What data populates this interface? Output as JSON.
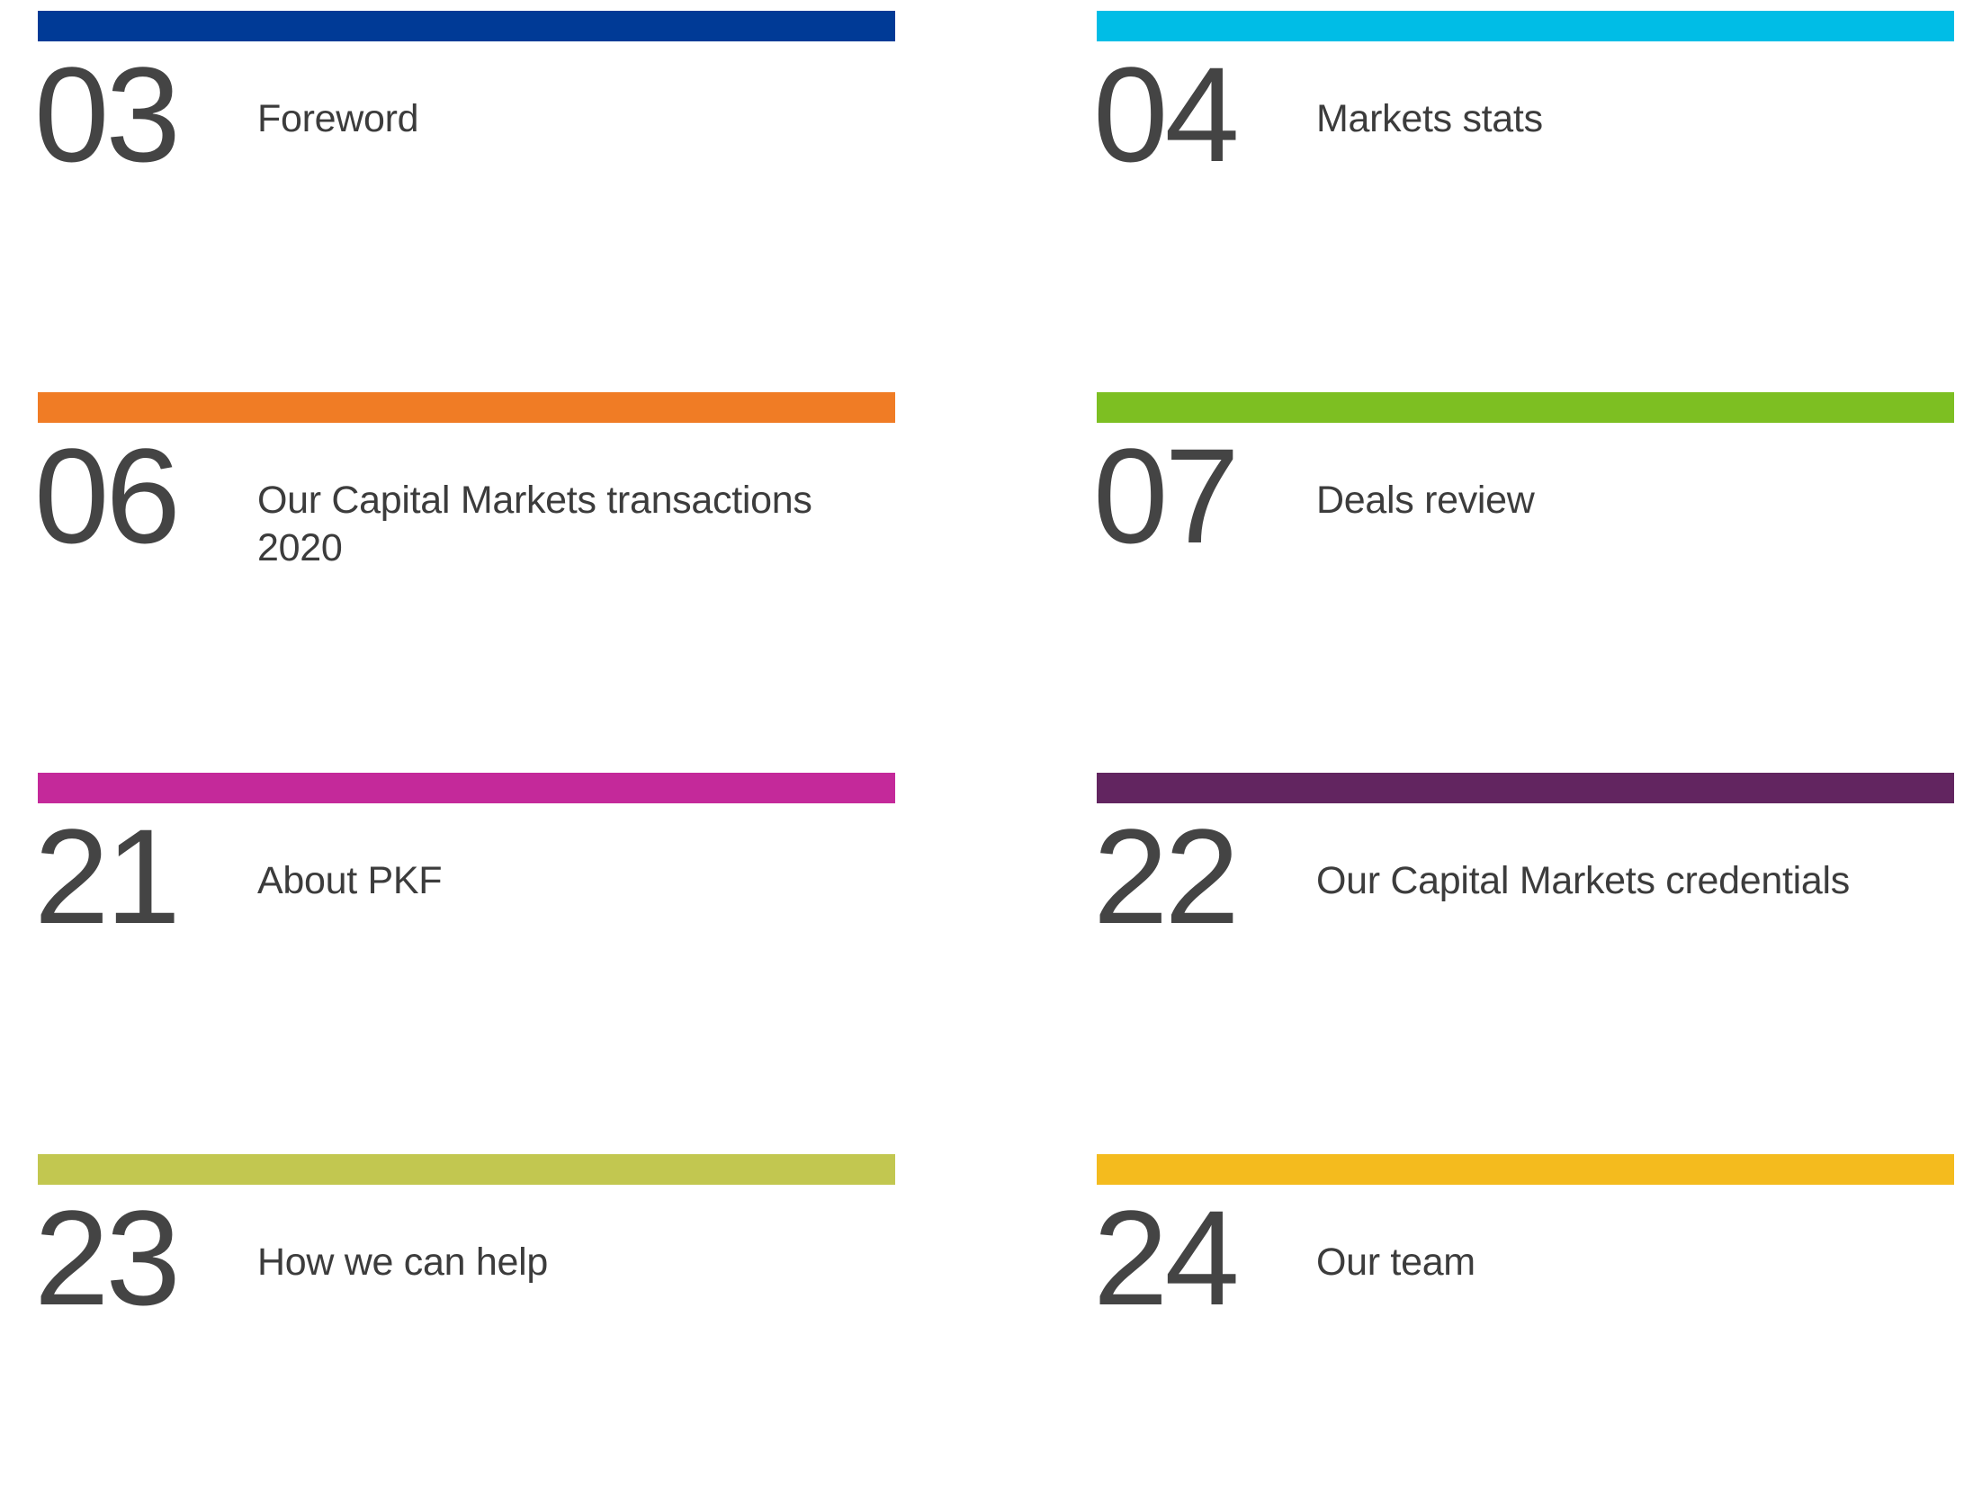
{
  "toc": {
    "entries": [
      {
        "number": "03",
        "title": "Foreword",
        "color": "#003a96"
      },
      {
        "number": "04",
        "title": "Markets stats",
        "color": "#00bde6"
      },
      {
        "number": "06",
        "title": "Our Capital Markets transactions 2020",
        "color": "#f07c25"
      },
      {
        "number": "07",
        "title": "Deals review",
        "color": "#7dbf22"
      },
      {
        "number": "21",
        "title": "About PKF",
        "color": "#c4299a"
      },
      {
        "number": "22",
        "title": "Our Capital Markets credentials",
        "color": "#622560"
      },
      {
        "number": "23",
        "title": "How we can help",
        "color": "#c2c750"
      },
      {
        "number": "24",
        "title": "Our team",
        "color": "#f4bb1e"
      }
    ]
  }
}
